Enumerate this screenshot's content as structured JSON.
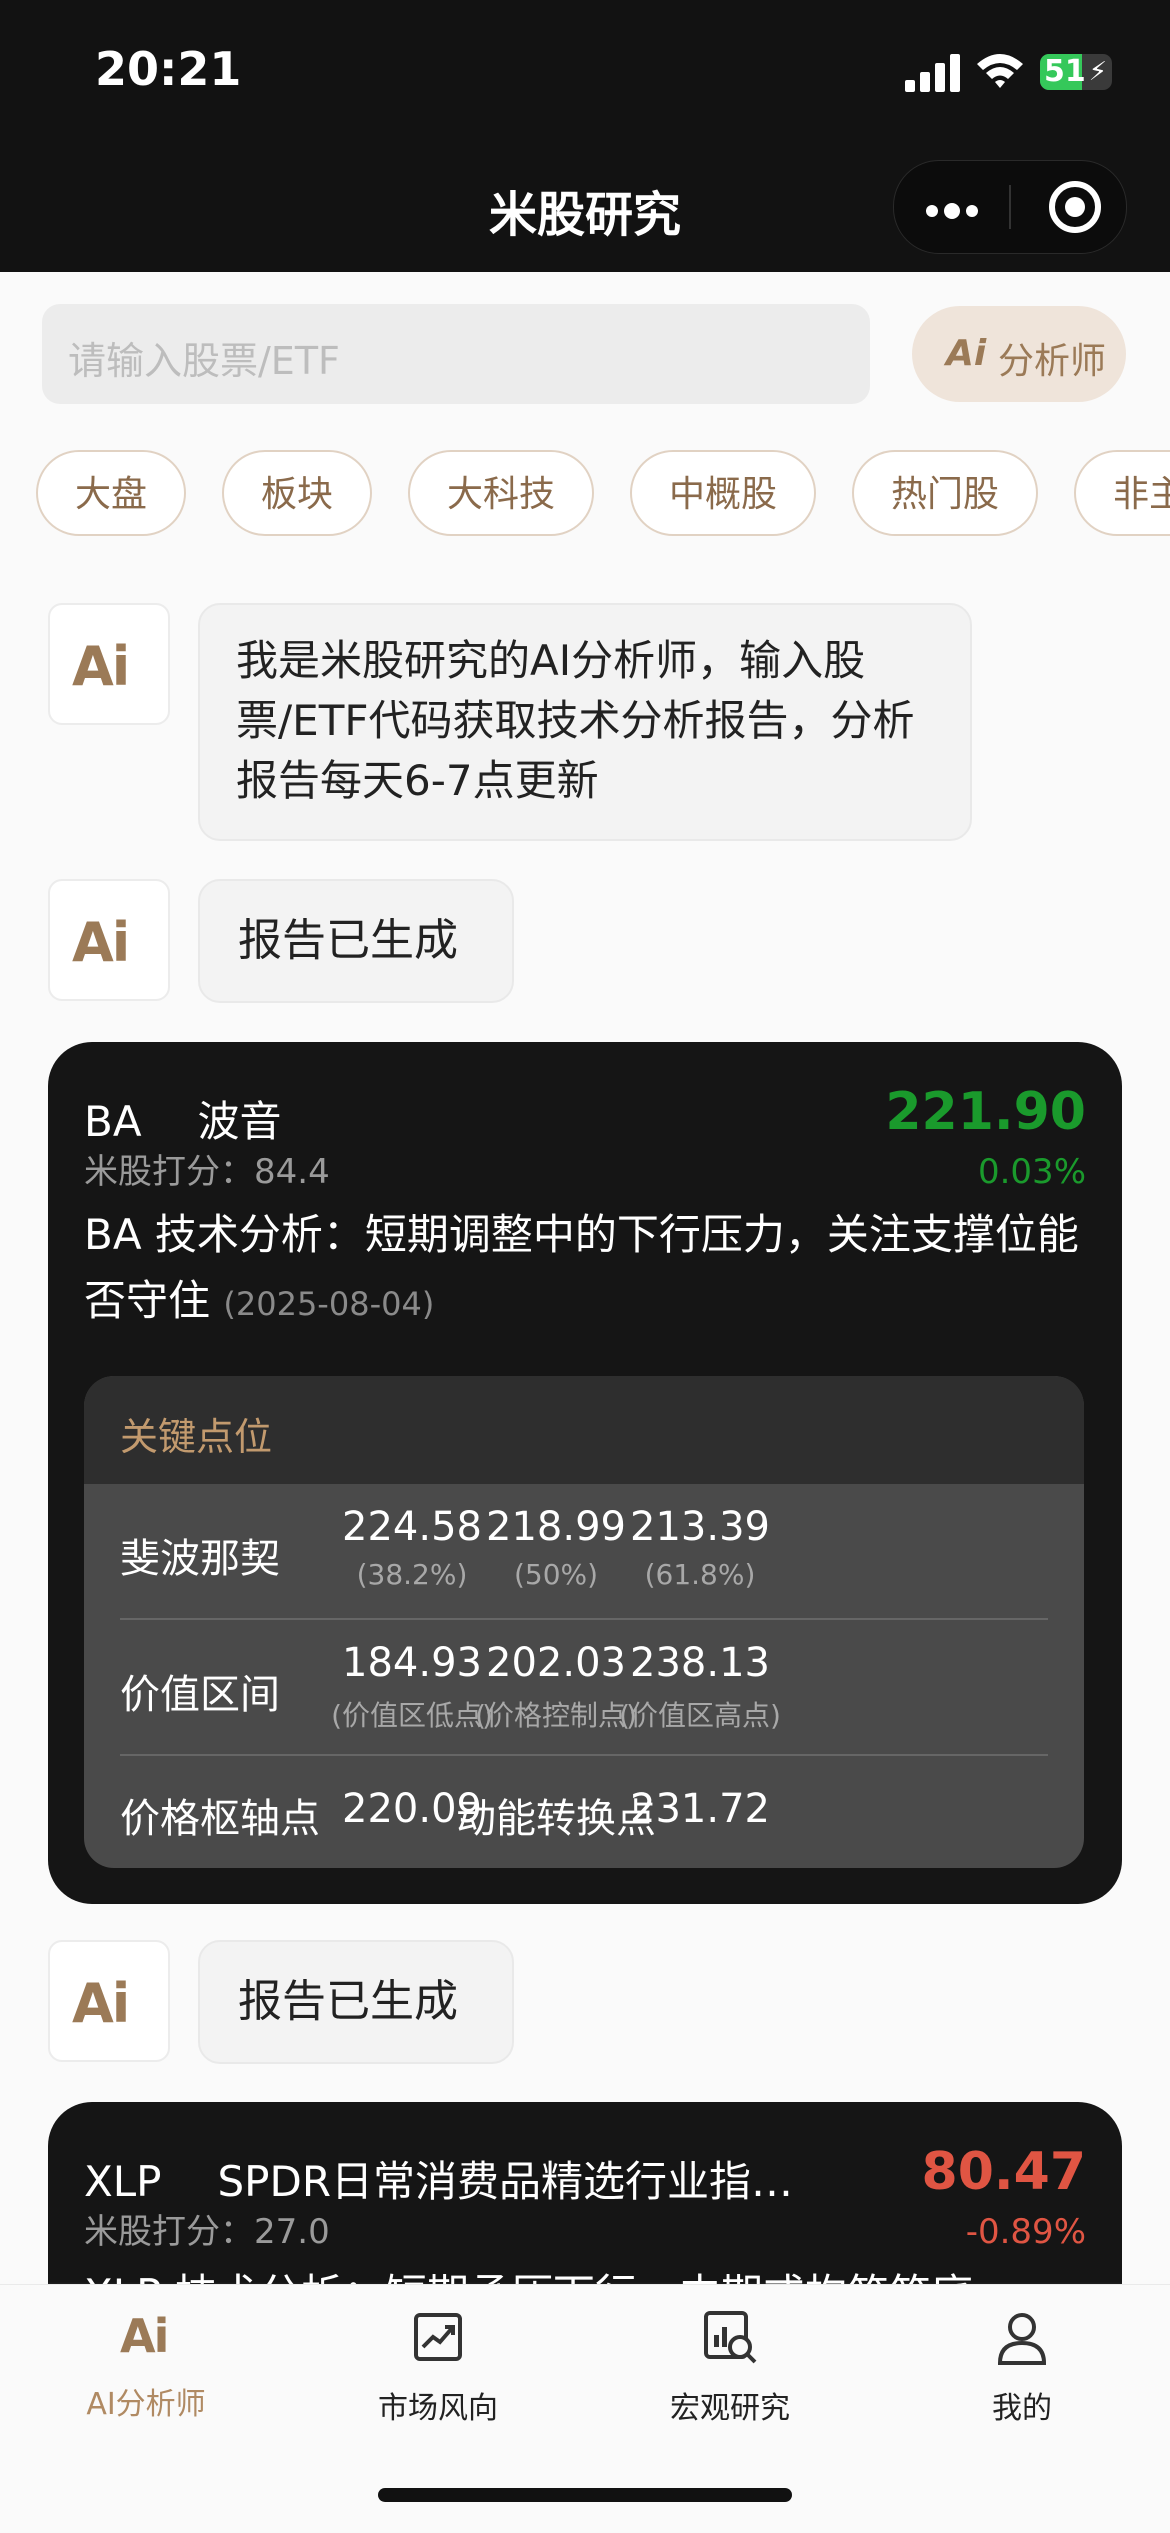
{
  "status_bar": {
    "time": "20:21",
    "battery": "51",
    "battery_level": 0.51
  },
  "header": {
    "title": "米股研究"
  },
  "search": {
    "placeholder": "请输入股票/ETF"
  },
  "analyst_button": {
    "icon_text": "Ai",
    "label": "分析师"
  },
  "chips": [
    "大盘",
    "板块",
    "大科技",
    "中概股",
    "热门股",
    "非主"
  ],
  "chat": {
    "avatar_text": "Ai",
    "intro": "我是米股研究的AI分析师，输入股票/ETF代码获取技术分析报告，分析报告每天6-7点更新",
    "generated_1": "报告已生成",
    "generated_2": "报告已生成"
  },
  "report_ba": {
    "symbol": "BA",
    "name": "波音",
    "score": "米股打分：84.4",
    "price": "221.90",
    "change": "0.03%",
    "headline": "BA 技术分析：短期调整中的下行压力，关注支撑位能否守住",
    "date": "(2025-08-04)",
    "key_levels": {
      "title": "关键点位",
      "fib": {
        "label": "斐波那契",
        "v1": "224.58",
        "s1": "(38.2%)",
        "v2": "218.99",
        "s2": "(50%)",
        "v3": "213.39",
        "s3": "(61.8%)"
      },
      "value": {
        "label": "价值区间",
        "v1": "184.93",
        "s1": "(价值区低点)",
        "v2": "202.03",
        "s2": "(价格控制点)",
        "v3": "238.13",
        "s3": "(价值区高点)"
      },
      "pivot": {
        "label": "价格枢轴点",
        "v1": "220.09",
        "mid": "动能转换点",
        "v3": "231.72"
      }
    }
  },
  "report_xlp": {
    "symbol": "XLP",
    "name": "SPDR日常消费品精选行业指…",
    "score": "米股打分：27.0",
    "price": "80.47",
    "change": "-0.89%",
    "headline_partial": "XLP 技术分析：短期承压下行，中期或构筑筑底"
  },
  "nav": {
    "items": [
      {
        "label": "AI分析师",
        "icon": "ai-analyst-icon",
        "active": true
      },
      {
        "label": "市场风向",
        "icon": "trend-chart-icon",
        "active": false
      },
      {
        "label": "宏观研究",
        "icon": "research-icon",
        "active": false
      },
      {
        "label": "我的",
        "icon": "person-icon",
        "active": false
      }
    ]
  },
  "colors": {
    "accent": "#9b7a57",
    "up": "#1a9a2c",
    "down": "#e05543",
    "card": "#151515"
  }
}
